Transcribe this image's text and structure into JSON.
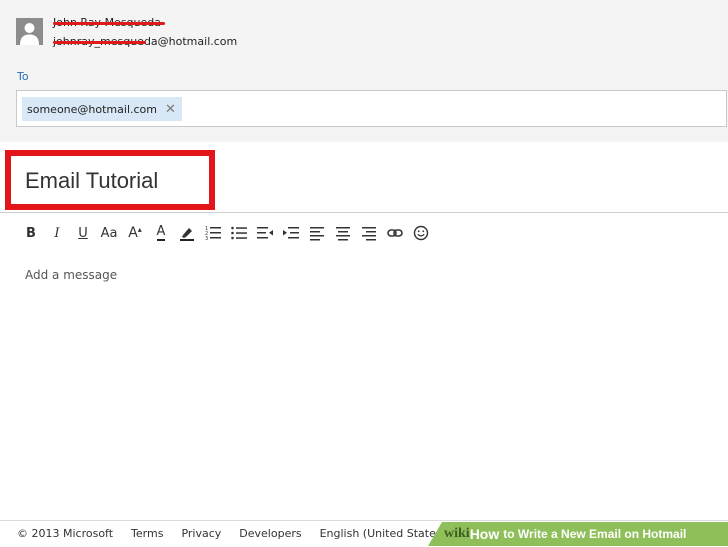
{
  "sender": {
    "name": "John Ray Mesqueda",
    "email_visible_suffix": "@hotmail.com",
    "email_redacted_prefix": "johnray_mesqueda"
  },
  "to": {
    "label": "To",
    "recipients": [
      {
        "email": "someone@hotmail.com",
        "remove_glyph": "✕"
      }
    ]
  },
  "subject": {
    "value": "Email Tutorial"
  },
  "toolbar": {
    "bold": "B",
    "italic": "I",
    "underline": "U",
    "font": "Aa",
    "size": "A",
    "color": "A"
  },
  "message": {
    "placeholder": "Add a message"
  },
  "footer": {
    "copyright": "© 2013 Microsoft",
    "terms": "Terms",
    "privacy": "Privacy",
    "developers": "Developers",
    "language": "English (United States)"
  },
  "banner": {
    "logo": "wiki",
    "how": "How",
    "title": "to Write a New Email on Hotmail"
  },
  "colors": {
    "accent": "#2a6ebb",
    "highlight": "#e3151a",
    "chip": "#d8e8f6",
    "banner": "#8fbf5a"
  }
}
